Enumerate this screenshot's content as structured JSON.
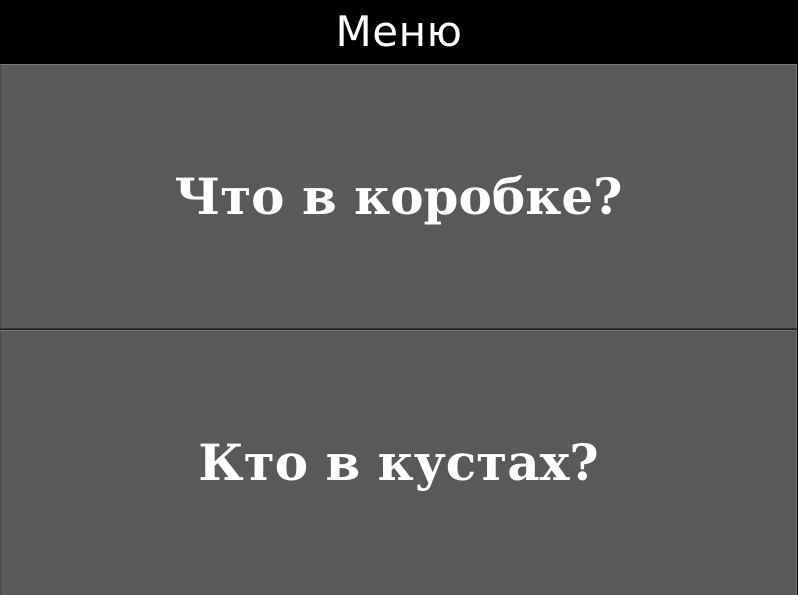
{
  "header": {
    "title": "Меню"
  },
  "menu": {
    "items": [
      {
        "label": "Что в коробке?"
      },
      {
        "label": "Кто в кустах?"
      }
    ]
  },
  "colors": {
    "header_background": "#000000",
    "button_background": "#595959",
    "text": "#ffffff"
  }
}
